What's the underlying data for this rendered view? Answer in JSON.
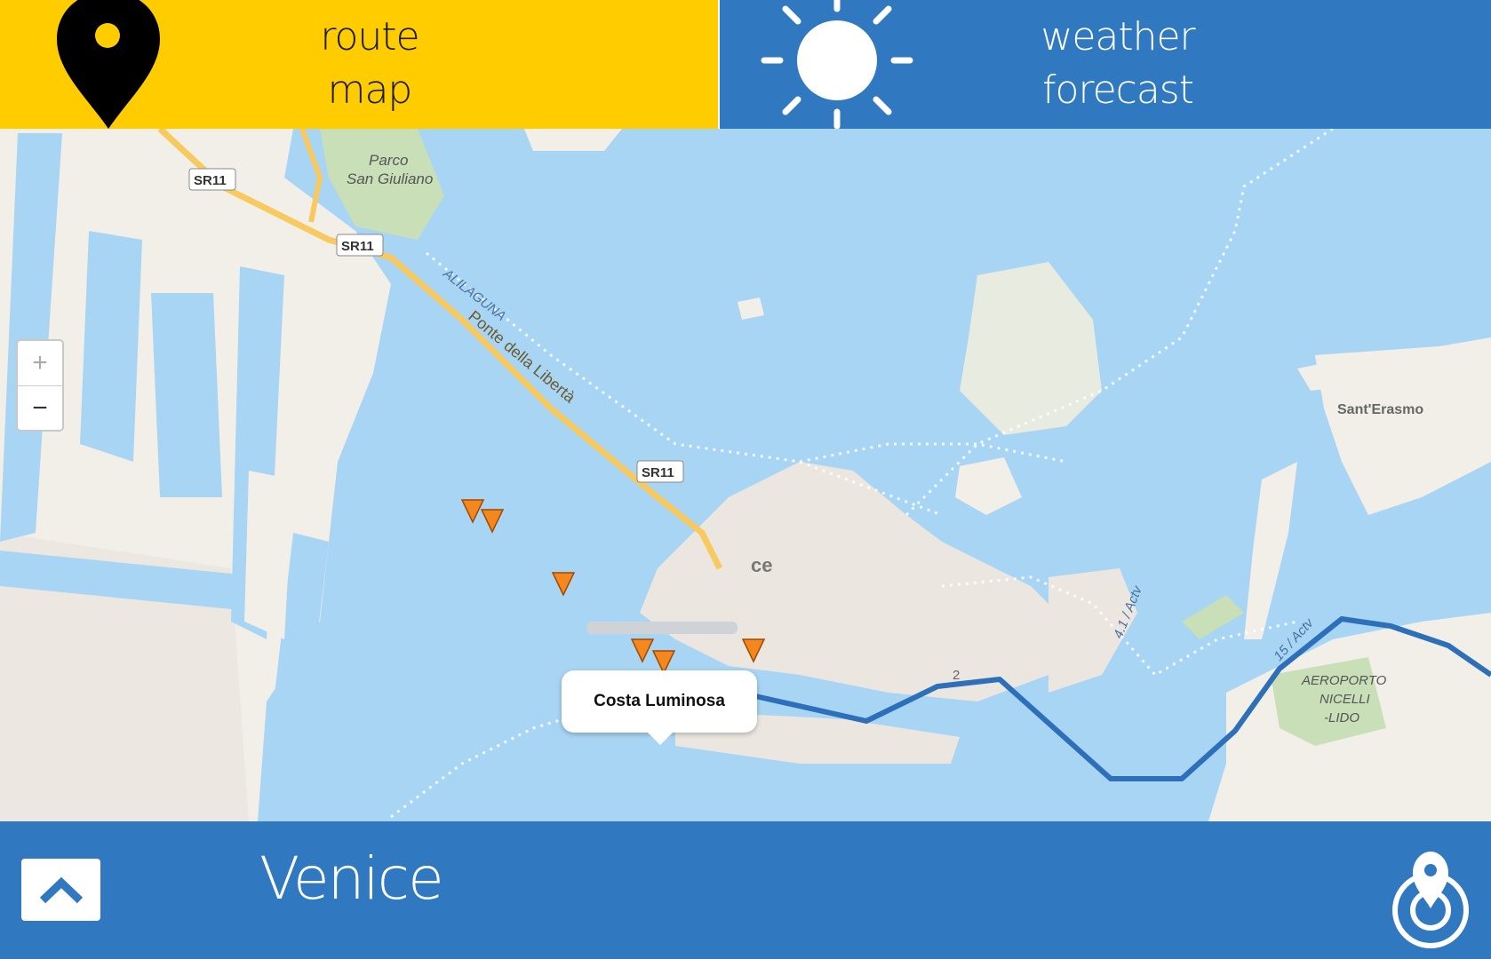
{
  "header": {
    "route_tab": {
      "line1": "route",
      "line2": "map",
      "icon": "map-pin-icon"
    },
    "weather_tab": {
      "line1": "weather",
      "line2": "forecast",
      "icon": "sun-icon"
    }
  },
  "map": {
    "zoom_in_label": "+",
    "zoom_out_label": "−",
    "popup_title": "Costa Luminosa",
    "labels": {
      "parco": "Parco",
      "parco2": "San Giuliano",
      "sr11_a": "SR11",
      "sr11_b": "SR11",
      "sr11_c": "SR11",
      "alilaguna": "ALILAGUNA",
      "ponte": "Ponte della Libertà",
      "venice_partial": "ce",
      "sant_erasmo": "Sant'Erasmo",
      "aeroporto1": "AEROPORTO",
      "aeroporto2": "NICELLI",
      "aeroporto3": "-LIDO",
      "actv_41": "4.1 / Actv",
      "actv_15": "15 / Actv",
      "route2": "2"
    },
    "colors": {
      "water": "#a9d5f4",
      "land": "#f2efe9",
      "route": "#2d6fb8",
      "marker": "#f5871f"
    }
  },
  "footer": {
    "city": "Venice",
    "up_icon": "chevron-up-icon",
    "locate_icon": "locate-pin-icon"
  }
}
